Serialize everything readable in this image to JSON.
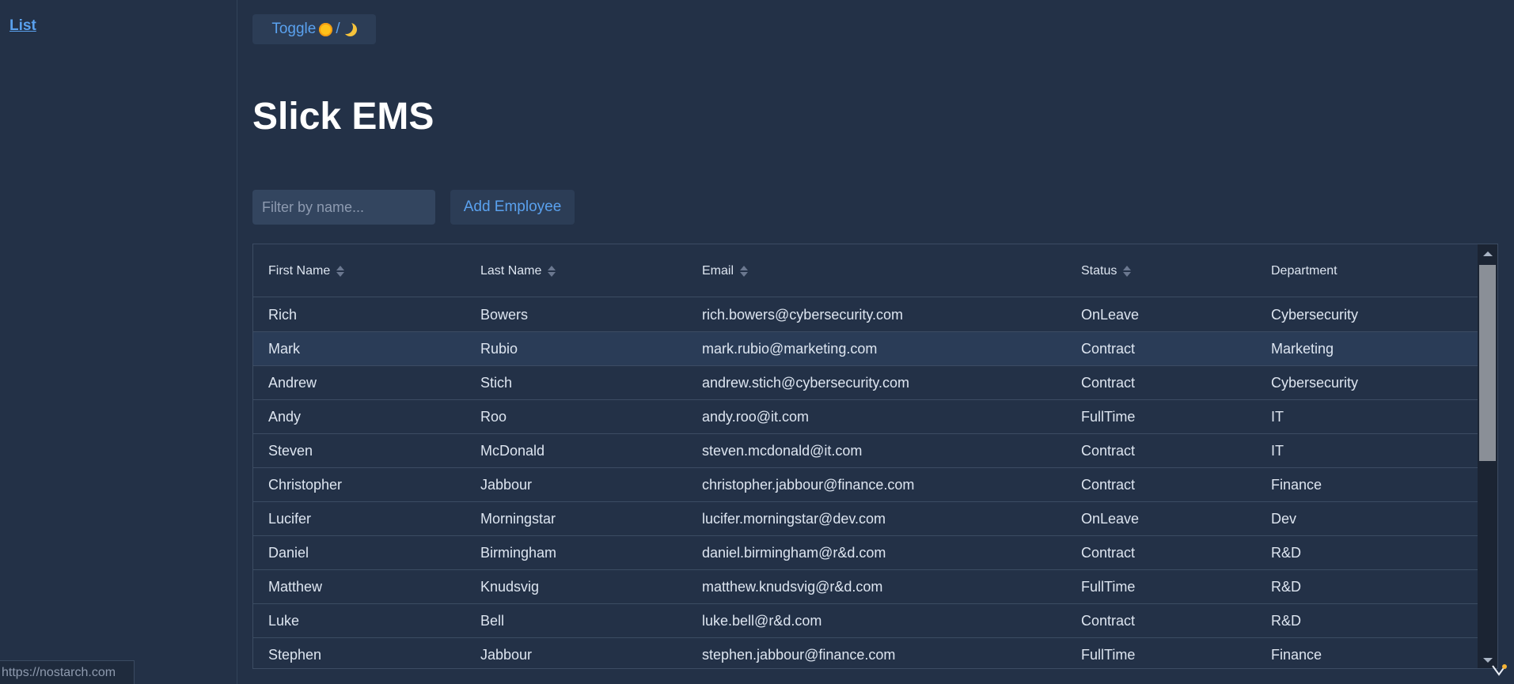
{
  "sidebar": {
    "nav_link": "List"
  },
  "toggle": {
    "label_before": "Toggle",
    "sep": "/"
  },
  "page": {
    "title": "Slick EMS"
  },
  "filter": {
    "placeholder": "Filter by name..."
  },
  "add_button": {
    "label": "Add Employee"
  },
  "table": {
    "headers": [
      "First Name",
      "Last Name",
      "Email",
      "Status",
      "Department"
    ],
    "rows": [
      [
        "Rich",
        "Bowers",
        "rich.bowers@cybersecurity.com",
        "OnLeave",
        "Cybersecurity"
      ],
      [
        "Mark",
        "Rubio",
        "mark.rubio@marketing.com",
        "Contract",
        "Marketing"
      ],
      [
        "Andrew",
        "Stich",
        "andrew.stich@cybersecurity.com",
        "Contract",
        "Cybersecurity"
      ],
      [
        "Andy",
        "Roo",
        "andy.roo@it.com",
        "FullTime",
        "IT"
      ],
      [
        "Steven",
        "McDonald",
        "steven.mcdonald@it.com",
        "Contract",
        "IT"
      ],
      [
        "Christopher",
        "Jabbour",
        "christopher.jabbour@finance.com",
        "Contract",
        "Finance"
      ],
      [
        "Lucifer",
        "Morningstar",
        "lucifer.morningstar@dev.com",
        "OnLeave",
        "Dev"
      ],
      [
        "Daniel",
        "Birmingham",
        "daniel.birmingham@r&d.com",
        "Contract",
        "R&D"
      ],
      [
        "Matthew",
        "Knudsvig",
        "matthew.knudsvig@r&d.com",
        "FullTime",
        "R&D"
      ],
      [
        "Luke",
        "Bell",
        "luke.bell@r&d.com",
        "Contract",
        "R&D"
      ],
      [
        "Stephen",
        "Jabbour",
        "stephen.jabbour@finance.com",
        "FullTime",
        "Finance"
      ]
    ],
    "selected_row_index": 1
  },
  "status_bar": {
    "url": "https://nostarch.com"
  },
  "colors": {
    "background": "#233147",
    "accent": "#5aa1ee",
    "selected_row": "#2a3c57"
  }
}
